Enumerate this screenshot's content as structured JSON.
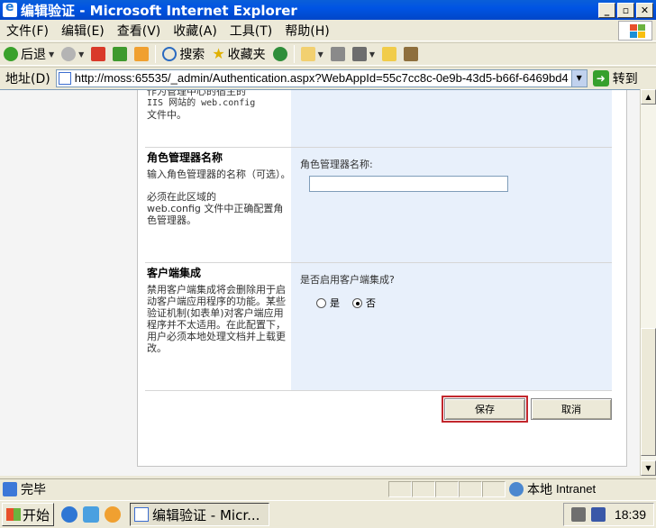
{
  "window": {
    "title": "编辑验证 - Microsoft Internet Explorer"
  },
  "menu": [
    "文件(F)",
    "编辑(E)",
    "查看(V)",
    "收藏(A)",
    "工具(T)",
    "帮助(H)"
  ],
  "toolbar": {
    "back": "后退",
    "search": "搜索",
    "favorites": "收藏夹"
  },
  "address": {
    "label": "地址(D)",
    "url": "http://moss:65535/_admin/Authentication.aspx?WebAppId=55c7cc8c-0e9b-43d5-b66f-6469bd48",
    "go": "转到"
  },
  "content": {
    "top_fragment": {
      "line1": "作为管理中心的宿主的",
      "line2": "IIS 网站的 web.config",
      "line3": "文件中。"
    },
    "role_manager": {
      "title": "角色管理器名称",
      "desc1": "输入角色管理器的名称（可选）。",
      "desc2a": "必须在此区域的",
      "desc2b": "web.config 文件中正确配置角色管理器。",
      "field_label": "角色管理器名称:",
      "field_value": ""
    },
    "client_integration": {
      "title": "客户端集成",
      "desc": "禁用客户端集成将会删除用于启动客户端应用程序的功能。某些验证机制(如表单)对客户端应用程序并不太适用。在此配置下，用户必须本地处理文档并上载更改。",
      "question": "是否启用客户端集成?",
      "yes": "是",
      "no": "否",
      "selected": "no"
    },
    "buttons": {
      "save": "保存",
      "cancel": "取消"
    }
  },
  "status": {
    "text": "完毕",
    "zone_cn": "本地",
    "zone_en": "Intranet"
  },
  "taskbar": {
    "start": "开始",
    "task": "编辑验证 - Micr...",
    "clock": "18:39"
  }
}
